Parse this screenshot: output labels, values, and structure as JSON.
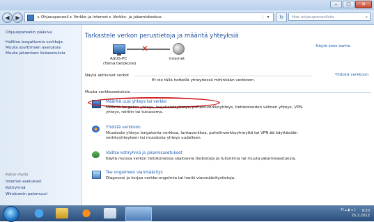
{
  "titlebar": {
    "minimize": "–",
    "maximize": "□",
    "close": "✕"
  },
  "address": {
    "back_icon": "back-arrow-icon",
    "forward_icon": "forward-arrow-icon",
    "crumbs": [
      "Ohjauspaneeli",
      "Verkko ja Internet",
      "Verkko- ja jakamiskeskus"
    ],
    "search_placeholder": "Hae ohjauspaneelista"
  },
  "sidebar": {
    "home": "Ohjauspaneelin pääsivu",
    "links": [
      "Hallitse langattomia verkkoja",
      "Muuta sovittimien asetuksia",
      "Muuta jakamisen lisäasetuksia"
    ],
    "see_also": "Katso myös",
    "see_also_links": [
      "Internet-asetukset",
      "Kotiryhmä",
      "Windowsin palomuuri"
    ]
  },
  "main": {
    "title": "Tarkastele verkon perustietoja ja määritä yhteyksiä",
    "full_map": "Näytä koko kartta",
    "pc_name": "ASUS-PC",
    "pc_sub": "(Tämä tietokone)",
    "internet": "Internet",
    "active_networks": "Näytä aktiiviset verkot",
    "connect_link": "Yhdistä verkkoon",
    "no_connection": "Et ole tällä hetkellä yhteydessä mihinkään verkkoon.",
    "change_settings": "Muuta verkkoasetuksia",
    "tasks": [
      {
        "link": "Määritä uusi yhteys tai verkko",
        "desc": "Määritä langaton yhteys, laajakaistayhteys, puhelinverkkoyhteys, tietokoneiden välinen yhteys, VPN-yhteys, reititin tai tukiasema."
      },
      {
        "link": "Yhdistä verkkoon",
        "desc": "Muodosta yhteys langatonta verkkoa, lankaverkkoa, puhelinverkkoyhteyttä tai VPN:ää käyttävään verkkoyhteyteen tai muodosta yhteys uudelleen."
      },
      {
        "link": "Valitse kotiryhmä ja jakamisasetukset",
        "desc": "Käytä muissa verkon tietokoneissa sijaitsevia tiedostoja ja tulostimia tai muuta jakamisasetuksia."
      },
      {
        "link": "Tee ongelmien vianmääritys",
        "desc": "Diagnosoi ja korjaa verkko-ongelmia tai hanki vianmääritystietoja."
      }
    ]
  },
  "taskbar": {
    "tray": "FI",
    "time": "9:33",
    "date": "25.2.2012"
  }
}
